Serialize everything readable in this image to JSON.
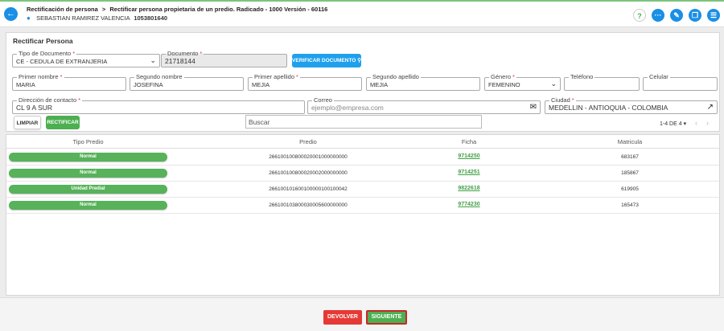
{
  "header": {
    "breadcrumb_parent": "Rectificación de persona",
    "breadcrumb_sep": ">",
    "breadcrumb_current": "Rectificar persona propietaria de un predio. Radicado - 1000 Versión - 60116",
    "user_name": "SEBASTIAN RAMIREZ VALENCIA",
    "user_doc": "1053801640",
    "icons": [
      "back-arrow-icon",
      "help-icon",
      "more-icon",
      "attachment-icon",
      "copy-icon",
      "chat-icon"
    ]
  },
  "form": {
    "title": "Rectificar Persona",
    "tipo_documento": {
      "label": "Tipo de Documento",
      "required": "*",
      "value": "CE - CEDULA DE EXTRANJERIA"
    },
    "documento": {
      "label": "Documento",
      "required": "*",
      "value": "21718144"
    },
    "verify_label": "VERIFICAR DOCUMENTO",
    "primer_nombre": {
      "label": "Primer nombre",
      "required": "*",
      "value": "MARIA"
    },
    "segundo_nombre": {
      "label": "Segundo nombre",
      "value": "JOSEFINA"
    },
    "primer_apellido": {
      "label": "Primer apellido",
      "required": "*",
      "value": "MEJIA"
    },
    "segundo_apellido": {
      "label": "Segundo apellido",
      "value": "MEJIA"
    },
    "genero": {
      "label": "Género",
      "required": "*",
      "value": "FEMENINO"
    },
    "telefono": {
      "label": "Teléfono",
      "value": ""
    },
    "celular": {
      "label": "Celular",
      "value": ""
    },
    "direccion": {
      "label": "Dirección de contacto",
      "required": "*",
      "value": "CL 9 A SUR"
    },
    "correo": {
      "label": "Correo",
      "placeholder": "ejemplo@empresa.com"
    },
    "ciudad": {
      "label": "Ciudad",
      "required": "*",
      "value": "MEDELLIN - ANTIOQUIA - COLOMBIA"
    },
    "clear_label": "LIMPIAR",
    "rectify_label": "RECTIFICAR",
    "search_placeholder": "Buscar",
    "pager_text": "1-4 DE 4",
    "pager_caret": "▾"
  },
  "table": {
    "headers": [
      "Tipo Predio",
      "Predio",
      "Ficha",
      "Matricula"
    ],
    "rows": [
      {
        "tipo": "Normal",
        "predio": "266100100800020001000000000",
        "ficha": "9714250",
        "matricula": "683167"
      },
      {
        "tipo": "Normal",
        "predio": "266100100800020002000000000",
        "ficha": "9714251",
        "matricula": "185867"
      },
      {
        "tipo": "Unidad Predial",
        "predio": "266100101600100000100100042",
        "ficha": "9822618",
        "matricula": "619905"
      },
      {
        "tipo": "Normal",
        "predio": "266100103800030005600000000",
        "ficha": "9774230",
        "matricula": "165473"
      }
    ]
  },
  "footer": {
    "back_label": "DEVOLVER",
    "next_label": "SIGUIENTE"
  },
  "colors": {
    "primary": "#1a8fe6",
    "success": "#4caf50",
    "danger": "#e53935"
  }
}
